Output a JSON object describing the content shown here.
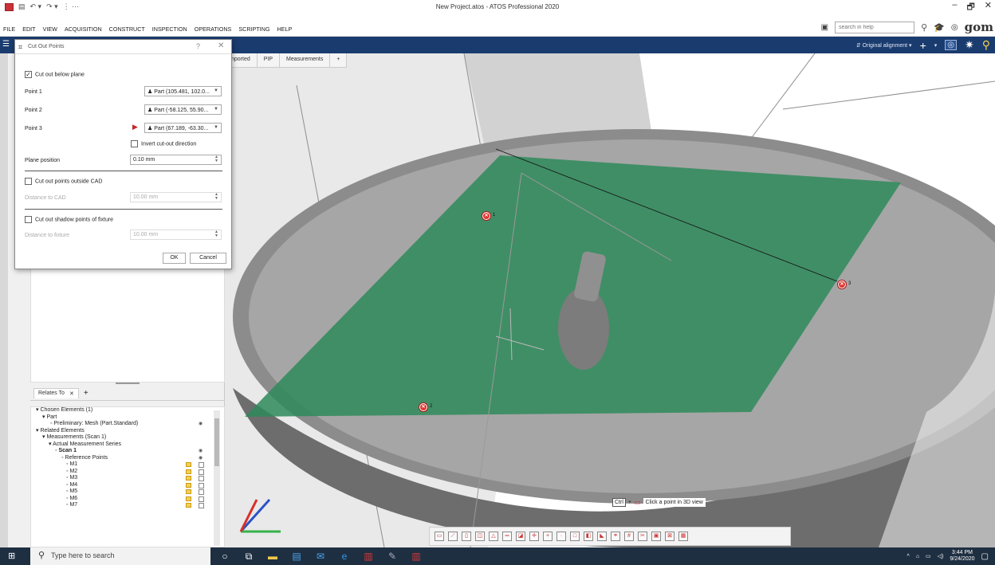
{
  "window": {
    "title": "New Project.atos - ATOS Professional 2020",
    "minimize": "–",
    "maximize": "🗗",
    "close": "✕"
  },
  "menu": [
    "FILE",
    "EDIT",
    "VIEW",
    "ACQUISITION",
    "CONSTRUCT",
    "INSPECTION",
    "OPERATIONS",
    "SCRIPTING",
    "HELP"
  ],
  "help_search_placeholder": "search in help",
  "logo": "gom",
  "toolbar": {
    "alignment_label": "Original alignment",
    "alignment_dropdown": "▾",
    "add": "+"
  },
  "view_tabs": [
    "nported",
    "PIP",
    "Measurements",
    "+"
  ],
  "dialog": {
    "title": "Cut Out Points",
    "help": "?",
    "close": "✕",
    "cut_below_plane": {
      "label": "Cut out below plane",
      "checked": true
    },
    "point1": {
      "label": "Point 1",
      "value": "Part (105.481, 102.0..."
    },
    "point2": {
      "label": "Point 2",
      "value": "Part (-58.125, 55.90..."
    },
    "point3": {
      "label": "Point 3",
      "value": "Part (67.189, -63.30..."
    },
    "invert": {
      "label": "Invert cut-out direction",
      "checked": false
    },
    "plane_position": {
      "label": "Plane position",
      "value": "0.10 mm"
    },
    "outside_cad": {
      "label": "Cut out points outside CAD",
      "checked": false
    },
    "distance_cad": {
      "label": "Distance to CAD",
      "value": "10.00 mm"
    },
    "shadow_points": {
      "label": "Cut out shadow points of fixture",
      "checked": false
    },
    "distance_fixture": {
      "label": "Distance to fixture",
      "value": "10.00 mm"
    },
    "ok": "OK",
    "cancel": "Cancel"
  },
  "relates_tab": {
    "label": "Relates To",
    "close": "✕",
    "add": "+"
  },
  "tree": [
    {
      "indent": 2,
      "text": "Chosen Elements (1)",
      "kind": "header"
    },
    {
      "indent": 10,
      "text": "Part",
      "kind": "node"
    },
    {
      "indent": 20,
      "text": "Preliminary: Mesh (Part.Standard)",
      "kind": "eye"
    },
    {
      "indent": 2,
      "text": "Related Elements",
      "kind": "header"
    },
    {
      "indent": 10,
      "text": "Measurements (Scan 1)",
      "kind": "node"
    },
    {
      "indent": 18,
      "text": "Actual Measurement Series",
      "kind": "node"
    },
    {
      "indent": 26,
      "text": "Scan 1",
      "kind": "eye"
    },
    {
      "indent": 34,
      "text": "Reference Points",
      "kind": "eye"
    },
    {
      "indent": 40,
      "text": "M1",
      "kind": "lock"
    },
    {
      "indent": 40,
      "text": "M2",
      "kind": "lock"
    },
    {
      "indent": 40,
      "text": "M3",
      "kind": "lock"
    },
    {
      "indent": 40,
      "text": "M4",
      "kind": "lock"
    },
    {
      "indent": 40,
      "text": "M5",
      "kind": "lock"
    },
    {
      "indent": 40,
      "text": "M6",
      "kind": "lock"
    },
    {
      "indent": 40,
      "text": "M7",
      "kind": "lock"
    }
  ],
  "hint": {
    "key": "Ctrl",
    "plus": "+",
    "message": "Click a point in 3D view"
  },
  "markers": [
    {
      "label": "1",
      "symbol": "✕"
    },
    {
      "label": "2",
      "symbol": "✕"
    },
    {
      "label": "3",
      "symbol": "✕"
    }
  ],
  "taskbar": {
    "search_placeholder": "Type here to search",
    "time": "3:44 PM",
    "date": "9/24/2020"
  },
  "colors": {
    "title_blue": "#1a3b6e",
    "plane_green": "#2e8a5a",
    "marker_red": "#e0352f",
    "taskbar": "#1f2f42"
  }
}
